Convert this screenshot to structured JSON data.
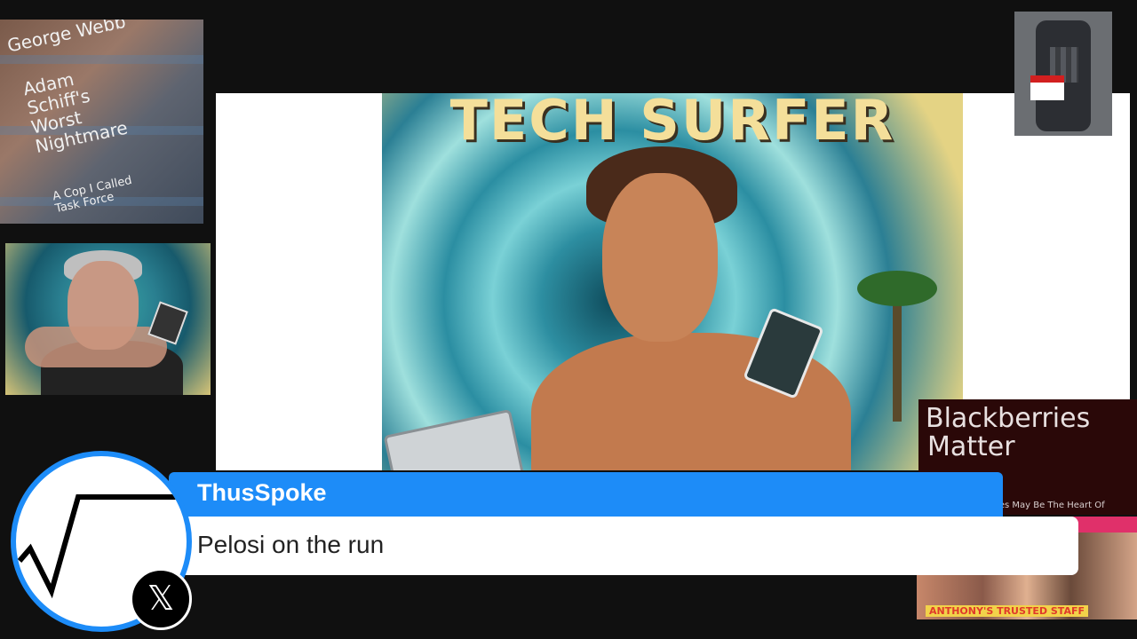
{
  "book_cover": {
    "author": "George Webb",
    "title_lines": "Adam\nSchiff's\nWorst\nNightmare",
    "subtitle_lines": "A Cop I Called\nTask Force"
  },
  "poster": {
    "title": "TECH SURFER"
  },
  "side_card": {
    "line1": "Blackberries",
    "line2": "Matter",
    "line3": "rries May Be The Heart Of"
  },
  "photo_card": {
    "caption": "ANTHONY'S TRUSTED STAFF"
  },
  "comment": {
    "username": "ThusSpoke",
    "message": "Pelosi on the run",
    "platform_icon": "x-logo-icon",
    "accent_color": "#1d8cf8"
  }
}
